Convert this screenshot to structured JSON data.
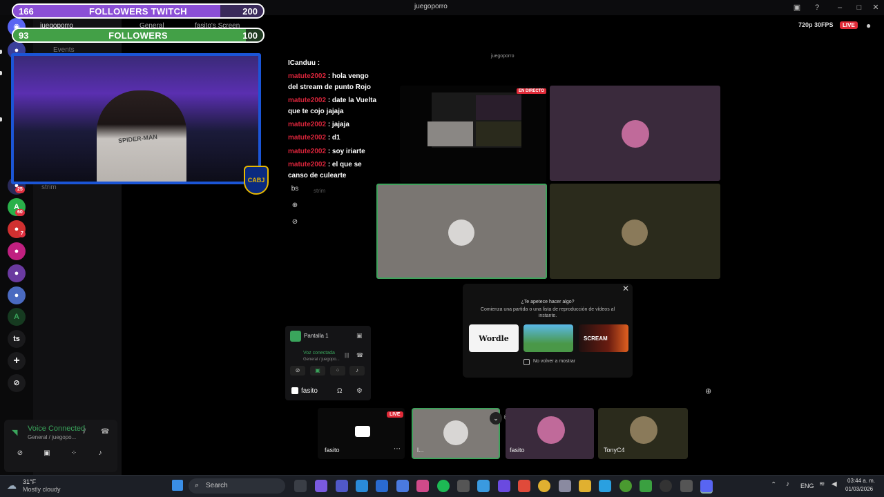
{
  "window": {
    "title": "juegoporro"
  },
  "overlay": {
    "bar_twitch": {
      "left_num": "166",
      "title": "FOLLOWERS TWITCH",
      "right_num": "200",
      "progress": 0.83,
      "color": "#8b4fd6"
    },
    "bar_followers": {
      "left_num": "93",
      "title": "FOLLOWERS",
      "right_num": "100",
      "progress": 0.93,
      "color": "#43a047"
    },
    "webcam_shirt_text": "SPIDER-MAN",
    "badge_text": "CABJ"
  },
  "sidebar": {
    "server_name": "juegoporro",
    "events_label": "Events",
    "channel_general": "General",
    "screen_share": "fasito's Screen",
    "voice_channel_bottom": "strim",
    "rail_letters": [
      "ts"
    ],
    "rail_badges": [
      "25",
      "60",
      "7"
    ]
  },
  "chat": {
    "header": "ICanduu :",
    "messages": [
      {
        "user": "matute2002",
        "text": ": hola vengo del stream de punto Rojo"
      },
      {
        "user": "matute2002",
        "text": ": date la Vuelta que te cojo jajaja"
      },
      {
        "user": "matute2002",
        "text": ": jajaja"
      },
      {
        "user": "matute2002",
        "text": ": d1"
      },
      {
        "user": "matute2002",
        "text": ": soy iriarte"
      },
      {
        "user": "matute2002",
        "text": ": el que se canso de culearte"
      }
    ]
  },
  "mid": {
    "inner_title": "juegoporro",
    "letters": "bs",
    "strim": "strim",
    "en_directo": "EN DIRECTO"
  },
  "activity": {
    "title": "¿Te apetece hacer algo?",
    "subtitle": "Comienza una partida o una lista de reproducción de vídeos al instante.",
    "games": [
      "Wordle",
      "",
      "SCREAM"
    ],
    "checkbox_label": "No volver a mostrar"
  },
  "voice_mid": {
    "pantalla": "Pantalla 1",
    "voz": "Voz conectada",
    "voz_sub": "General / juegopo...",
    "user": "fasito"
  },
  "bottom_tiles": [
    {
      "label": "fasito",
      "live": "LIVE"
    },
    {
      "label": "l..."
    },
    {
      "label": "fasito"
    },
    {
      "label": "TonyC4"
    }
  ],
  "voice_left": {
    "title": "Voice Connected",
    "sub": "General / juegopo..."
  },
  "stream_info": {
    "quality": "720p 30FPS",
    "live": "LIVE"
  },
  "taskbar": {
    "temp": "31°F",
    "weather": "Mostly cloudy",
    "search": "Search",
    "lang": "ENG",
    "time": "03:44 a. m.",
    "date": "01/03/2026"
  }
}
